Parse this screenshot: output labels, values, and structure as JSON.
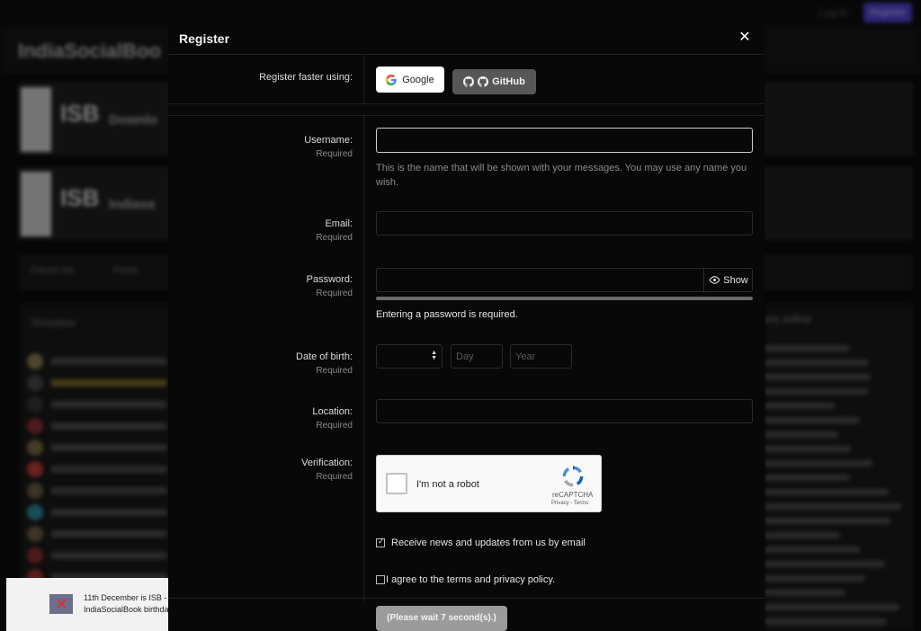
{
  "background": {
    "site_name": "IndiaSocialBoo",
    "login_label": "Log in",
    "register_label": "Register",
    "card_logo": "ISB",
    "cards": [
      "Downlo",
      "Indiase"
    ],
    "tabs": [
      "Forum list",
      "Posts"
    ],
    "feed_title": "Shoutbox",
    "side_title": "ers online",
    "toast": {
      "line1": "11th December is ISB -",
      "line2": "IndiaSocialBook birthda"
    }
  },
  "modal": {
    "title": "Register",
    "close_icon": "close-icon",
    "social": {
      "label": "Register faster using:",
      "google": "Google",
      "github": "GitHub"
    },
    "username": {
      "label": "Username:",
      "required": "Required",
      "value": "",
      "hint": "This is the name that will be shown with your messages. You may use any name you wish."
    },
    "email": {
      "label": "Email:",
      "required": "Required",
      "value": ""
    },
    "password": {
      "label": "Password:",
      "required": "Required",
      "value": "",
      "show_label": "Show",
      "message": "Entering a password is required."
    },
    "dob": {
      "label": "Date of birth:",
      "required": "Required",
      "day_placeholder": "Day",
      "year_placeholder": "Year"
    },
    "location": {
      "label": "Location:",
      "required": "Required",
      "value": ""
    },
    "verification": {
      "label": "Verification:",
      "required": "Required",
      "captcha_text": "I'm not a robot",
      "captcha_brand": "reCAPTCHA",
      "captcha_links": "Privacy - Terms"
    },
    "news_checkbox": {
      "label": "Receive news and updates from us by email",
      "checked": true
    },
    "terms_checkbox": {
      "label": "I agree to the terms and privacy policy.",
      "checked": false
    },
    "submit_label": "(Please wait 7 second(s).)"
  },
  "colors": {
    "accent": "#4b3fd0",
    "submit_disabled": "#9b9b9b",
    "github_button": "#575757"
  }
}
